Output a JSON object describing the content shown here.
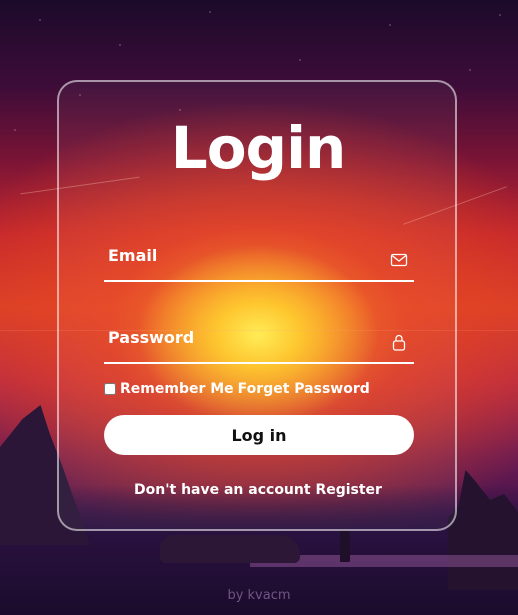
{
  "login": {
    "title": "Login",
    "email_label": "Email",
    "email_value": "",
    "password_label": "Password",
    "password_value": "",
    "remember_label": "Remember Me",
    "remember_checked": false,
    "forget_label": "Forget Password",
    "submit_label": "Log in",
    "register_prompt": "Don't have an account",
    "register_link": "Register"
  },
  "footer": {
    "credit": "by kvacm"
  },
  "icons": {
    "email": "envelope-icon",
    "password": "lock-icon"
  },
  "colors": {
    "card_border": "#ffffffcc",
    "button_bg": "#ffffff",
    "text": "#ffffff"
  }
}
